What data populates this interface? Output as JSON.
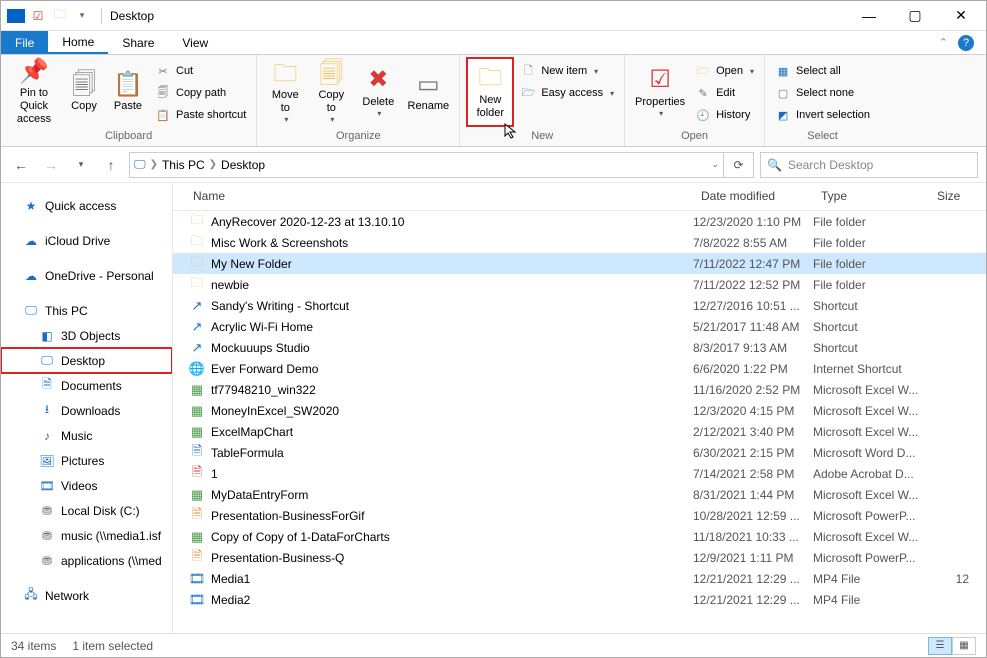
{
  "title": "Desktop",
  "tabs": {
    "file": "File",
    "home": "Home",
    "share": "Share",
    "view": "View"
  },
  "ribbon": {
    "clipboard": {
      "label": "Clipboard",
      "pin": "Pin to Quick\naccess",
      "copy": "Copy",
      "paste": "Paste",
      "cut": "Cut",
      "copy_path": "Copy path",
      "paste_shortcut": "Paste shortcut"
    },
    "organize": {
      "label": "Organize",
      "move_to": "Move\nto",
      "copy_to": "Copy\nto",
      "delete": "Delete",
      "rename": "Rename"
    },
    "new": {
      "label": "New",
      "new_folder": "New\nfolder",
      "new_item": "New item",
      "easy_access": "Easy access"
    },
    "open": {
      "label": "Open",
      "properties": "Properties",
      "open": "Open",
      "edit": "Edit",
      "history": "History"
    },
    "select": {
      "label": "Select",
      "select_all": "Select all",
      "select_none": "Select none",
      "invert": "Invert selection"
    }
  },
  "breadcrumb": {
    "root": "This PC",
    "leaf": "Desktop"
  },
  "search_placeholder": "Search Desktop",
  "nav": {
    "quick_access": "Quick access",
    "icloud": "iCloud Drive",
    "onedrive": "OneDrive - Personal",
    "this_pc": "This PC",
    "objects3d": "3D Objects",
    "desktop": "Desktop",
    "documents": "Documents",
    "downloads": "Downloads",
    "music": "Music",
    "pictures": "Pictures",
    "videos": "Videos",
    "local_disk": "Local Disk (C:)",
    "music_net": "music (\\\\media1.isf",
    "apps_net": "applications (\\\\med",
    "network": "Network"
  },
  "cols": {
    "name": "Name",
    "date": "Date modified",
    "type": "Type",
    "size": "Size"
  },
  "rows": [
    {
      "name": "AnyRecover 2020-12-23 at 13.10.10",
      "date": "12/23/2020 1:10 PM",
      "type": "File folder",
      "size": "",
      "icon": "folder"
    },
    {
      "name": "Misc Work & Screenshots",
      "date": "7/8/2022 8:55 AM",
      "type": "File folder",
      "size": "",
      "icon": "folder"
    },
    {
      "name": "My New Folder",
      "date": "7/11/2022 12:47 PM",
      "type": "File folder",
      "size": "",
      "icon": "folder",
      "sel": true
    },
    {
      "name": "newbie",
      "date": "7/11/2022 12:52 PM",
      "type": "File folder",
      "size": "",
      "icon": "folder"
    },
    {
      "name": "Sandy's Writing - Shortcut",
      "date": "12/27/2016 10:51 ...",
      "type": "Shortcut",
      "size": "",
      "icon": "shortcut"
    },
    {
      "name": "Acrylic Wi-Fi Home",
      "date": "5/21/2017 11:48 AM",
      "type": "Shortcut",
      "size": "",
      "icon": "shortcut"
    },
    {
      "name": "Mockuuups Studio",
      "date": "8/3/2017 9:13 AM",
      "type": "Shortcut",
      "size": "",
      "icon": "shortcut"
    },
    {
      "name": "Ever Forward Demo",
      "date": "6/6/2020 1:22 PM",
      "type": "Internet Shortcut",
      "size": "",
      "icon": "inet"
    },
    {
      "name": "tf77948210_win322",
      "date": "11/16/2020 2:52 PM",
      "type": "Microsoft Excel W...",
      "size": "",
      "icon": "excel"
    },
    {
      "name": "MoneyInExcel_SW2020",
      "date": "12/3/2020 4:15 PM",
      "type": "Microsoft Excel W...",
      "size": "",
      "icon": "excel"
    },
    {
      "name": "ExcelMapChart",
      "date": "2/12/2021 3:40 PM",
      "type": "Microsoft Excel W...",
      "size": "",
      "icon": "excel"
    },
    {
      "name": "TableFormula",
      "date": "6/30/2021 2:15 PM",
      "type": "Microsoft Word D...",
      "size": "",
      "icon": "word"
    },
    {
      "name": "1",
      "date": "7/14/2021 2:58 PM",
      "type": "Adobe Acrobat D...",
      "size": "",
      "icon": "pdf"
    },
    {
      "name": "MyDataEntryForm",
      "date": "8/31/2021 1:44 PM",
      "type": "Microsoft Excel W...",
      "size": "",
      "icon": "excel"
    },
    {
      "name": "Presentation-BusinessForGif",
      "date": "10/28/2021 12:59 ...",
      "type": "Microsoft PowerP...",
      "size": "",
      "icon": "ppt"
    },
    {
      "name": "Copy of Copy of 1-DataForCharts",
      "date": "11/18/2021 10:33 ...",
      "type": "Microsoft Excel W...",
      "size": "",
      "icon": "excel"
    },
    {
      "name": "Presentation-Business-Q",
      "date": "12/9/2021 1:11 PM",
      "type": "Microsoft PowerP...",
      "size": "",
      "icon": "ppt"
    },
    {
      "name": "Media1",
      "date": "12/21/2021 12:29 ...",
      "type": "MP4 File",
      "size": "12",
      "icon": "video"
    },
    {
      "name": "Media2",
      "date": "12/21/2021 12:29 ...",
      "type": "MP4 File",
      "size": "",
      "icon": "video"
    }
  ],
  "status": {
    "count": "34 items",
    "selected": "1 item selected"
  }
}
